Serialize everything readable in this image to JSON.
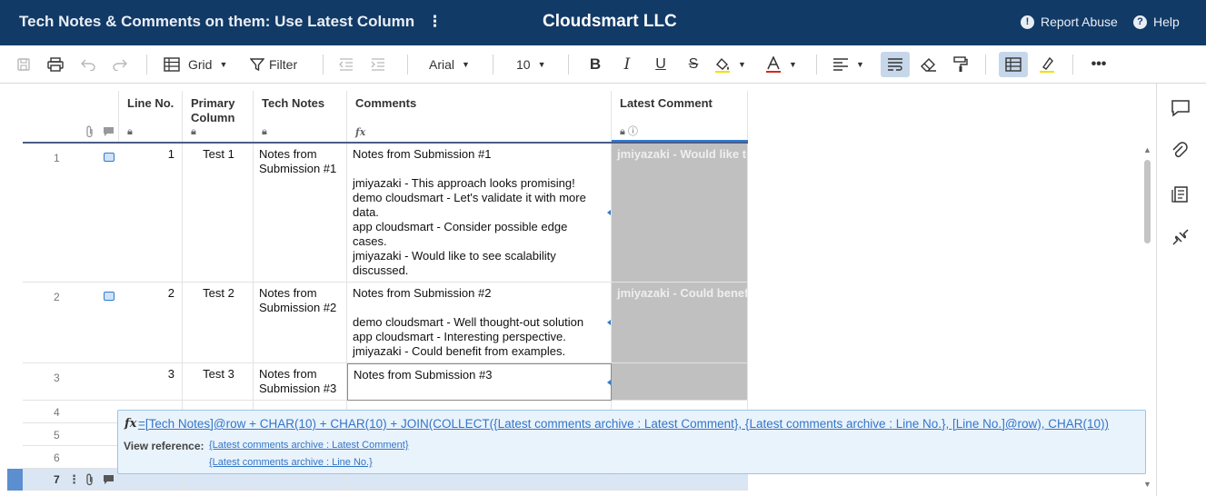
{
  "header": {
    "sheet_title": "Tech Notes & Comments on them: Use Latest Column",
    "title_menu": "⋮",
    "company": "Cloudsmart LLC",
    "report_abuse": "Report Abuse",
    "help": "Help"
  },
  "toolbar": {
    "view_label": "Grid",
    "filter_label": "Filter",
    "font": "Arial",
    "font_size": "10"
  },
  "columns": {
    "line_no": "Line No.",
    "primary": "Primary\nColumn",
    "tech_notes": "Tech Notes",
    "comments": "Comments",
    "latest": "Latest Comment",
    "fx_icon": "fx"
  },
  "rows": [
    {
      "num": "1",
      "line_no": "1",
      "primary": "Test 1",
      "tech_notes": "Notes from\nSubmission #1",
      "comments": "Notes from Submission #1\n\njmiyazaki - This approach looks promising!\ndemo cloudsmart - Let's validate it with more\ndata.\napp cloudsmart - Consider possible edge\ncases.\njmiyazaki - Would like to see scalability\ndiscussed.",
      "latest": "jmiyazaki - Would like to"
    },
    {
      "num": "2",
      "line_no": "2",
      "primary": "Test 2",
      "tech_notes": "Notes from\nSubmission #2",
      "comments": "Notes from Submission #2\n\ndemo cloudsmart - Well thought-out solution\napp cloudsmart - Interesting perspective.\njmiyazaki - Could benefit from examples.",
      "latest": "jmiyazaki - Could benef"
    },
    {
      "num": "3",
      "line_no": "3",
      "primary": "Test 3",
      "tech_notes": "Notes from\nSubmission #3",
      "comments": "Notes from Submission #3",
      "latest": ""
    }
  ],
  "empty_rows": [
    "4",
    "5",
    "6",
    "7"
  ],
  "formula_popup": {
    "formula": "=[Tech Notes]@row + CHAR(10) + CHAR(10) + JOIN(COLLECT({Latest comments archive : Latest Comment}, {Latest comments archive : Line No.}, [Line No.]@row), CHAR(10))",
    "view_reference_label": "View reference:",
    "references": [
      "{Latest comments archive : Latest Comment}",
      "{Latest comments archive : Line No.}"
    ]
  },
  "colors": {
    "header_bg": "#123a66",
    "accent": "#2f7ad0",
    "latest_col_bg": "#c0c0c0"
  }
}
